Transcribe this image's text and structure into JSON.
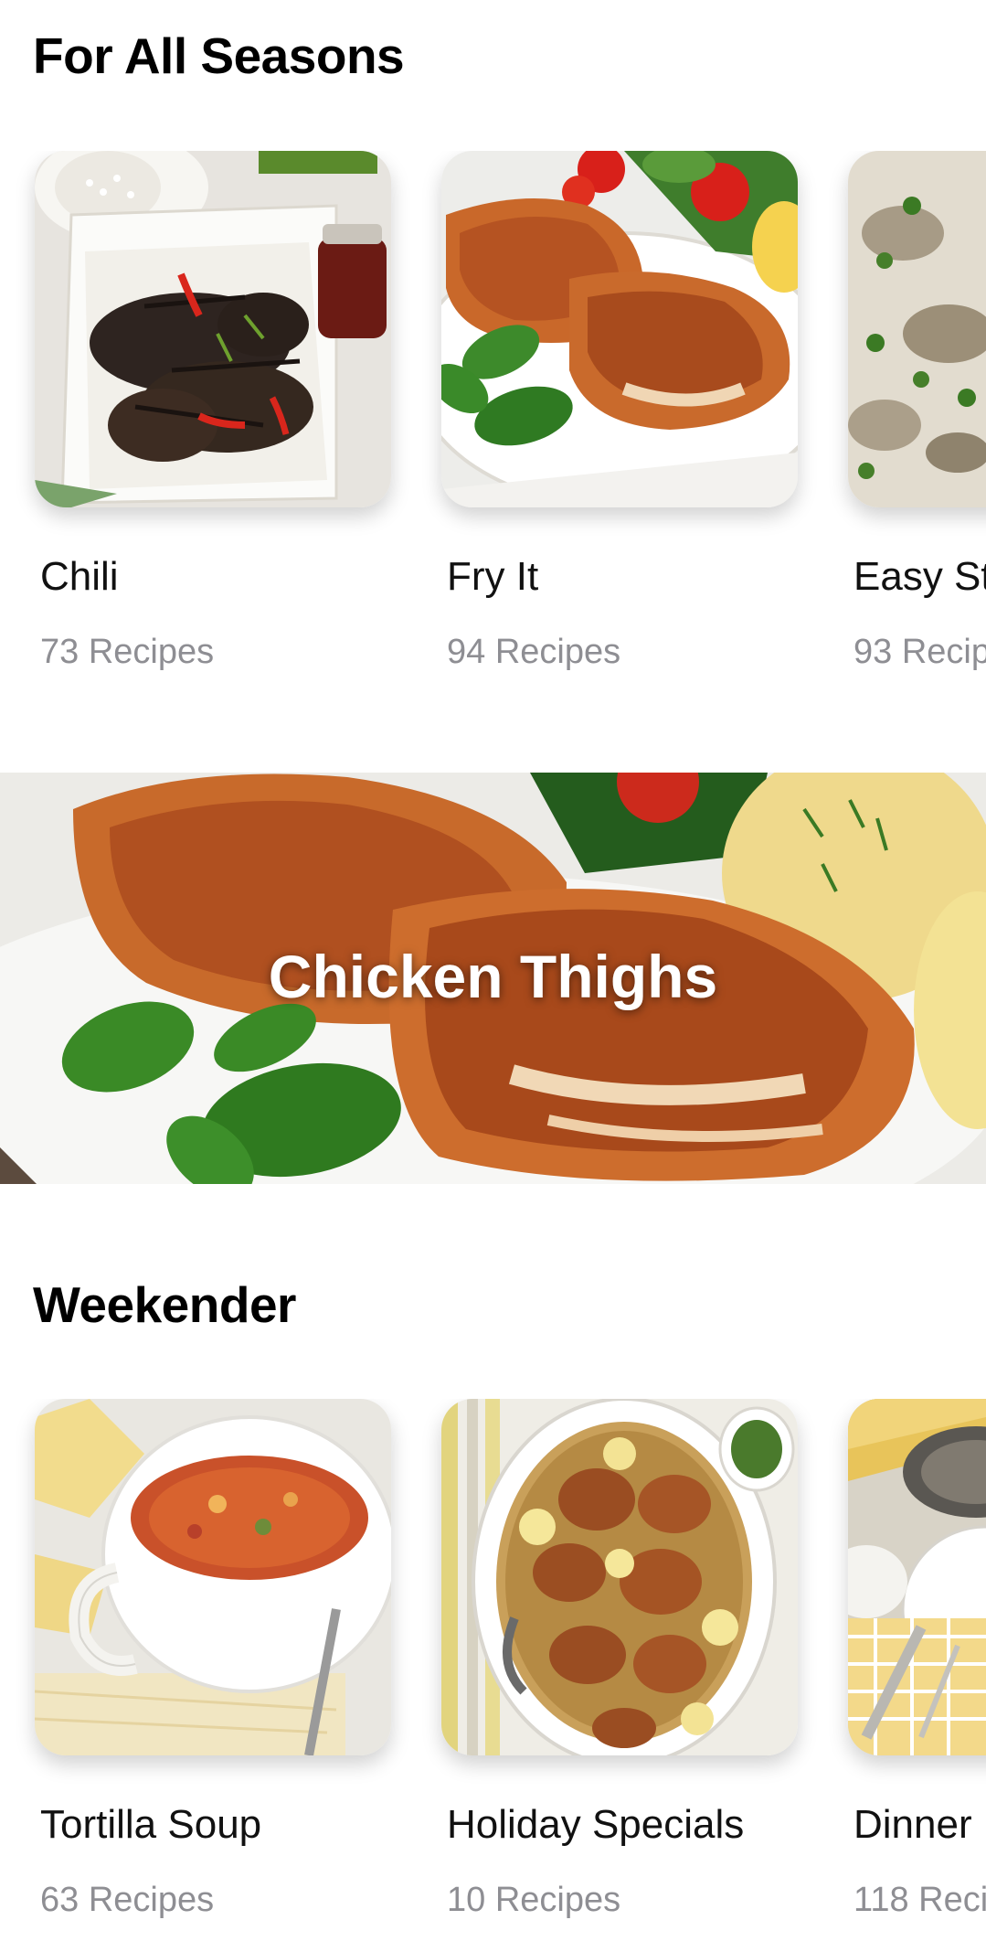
{
  "sections": [
    {
      "title": "For All Seasons",
      "cards": [
        {
          "title": "Chili",
          "count": "73 Recipes",
          "image": "grilled-chili-chicken-photo"
        },
        {
          "title": "Fry It",
          "count": "94 Recipes",
          "image": "fried-chicken-thighs-photo"
        },
        {
          "title": "Easy St",
          "count": "93 Recip",
          "image": "mushroom-cream-sauce-photo"
        }
      ]
    },
    {
      "title": "Weekender",
      "cards": [
        {
          "title": "Tortilla Soup",
          "count": "63 Recipes",
          "image": "tortilla-soup-photo"
        },
        {
          "title": "Holiday Specials",
          "count": "10 Recipes",
          "image": "chicken-chickpeas-platter-photo"
        },
        {
          "title": "Dinner",
          "count": "118 Reci",
          "image": "dinner-table-setting-photo"
        }
      ]
    }
  ],
  "banner": {
    "title": "Chicken Thighs",
    "image": "chicken-thighs-potatoes-photo"
  },
  "colors": {
    "background": "#ffffff",
    "title_text": "#000000",
    "count_text": "#8e8e93",
    "banner_text": "#ffffff"
  }
}
